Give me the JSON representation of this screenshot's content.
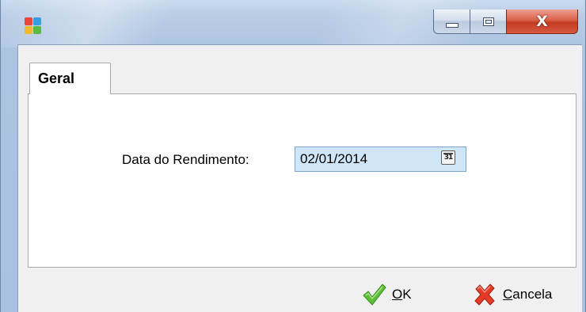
{
  "window": {
    "icon": "app-icon",
    "controls": {
      "minimize_icon": "minimize-icon",
      "maximize_icon": "maximize-icon",
      "close_glyph": "X"
    }
  },
  "tabs": [
    {
      "label": "Geral",
      "active": true
    }
  ],
  "form": {
    "date_label": "Data do Rendimento:",
    "date_value": "02/01/2014",
    "calendar_icon": "calendar-icon",
    "calendar_glyph": "31"
  },
  "buttons": {
    "ok": {
      "mnemonic": "O",
      "rest": "K",
      "icon": "checkmark-icon"
    },
    "cancel": {
      "mnemonic": "C",
      "rest": "ancela",
      "icon": "x-mark-icon"
    }
  },
  "colors": {
    "title_bar": "#b9cde6",
    "close_button": "#c33b23",
    "input_background": "#cfe5f8",
    "ok_icon": "#4caf2c",
    "cancel_icon": "#e0301e"
  }
}
